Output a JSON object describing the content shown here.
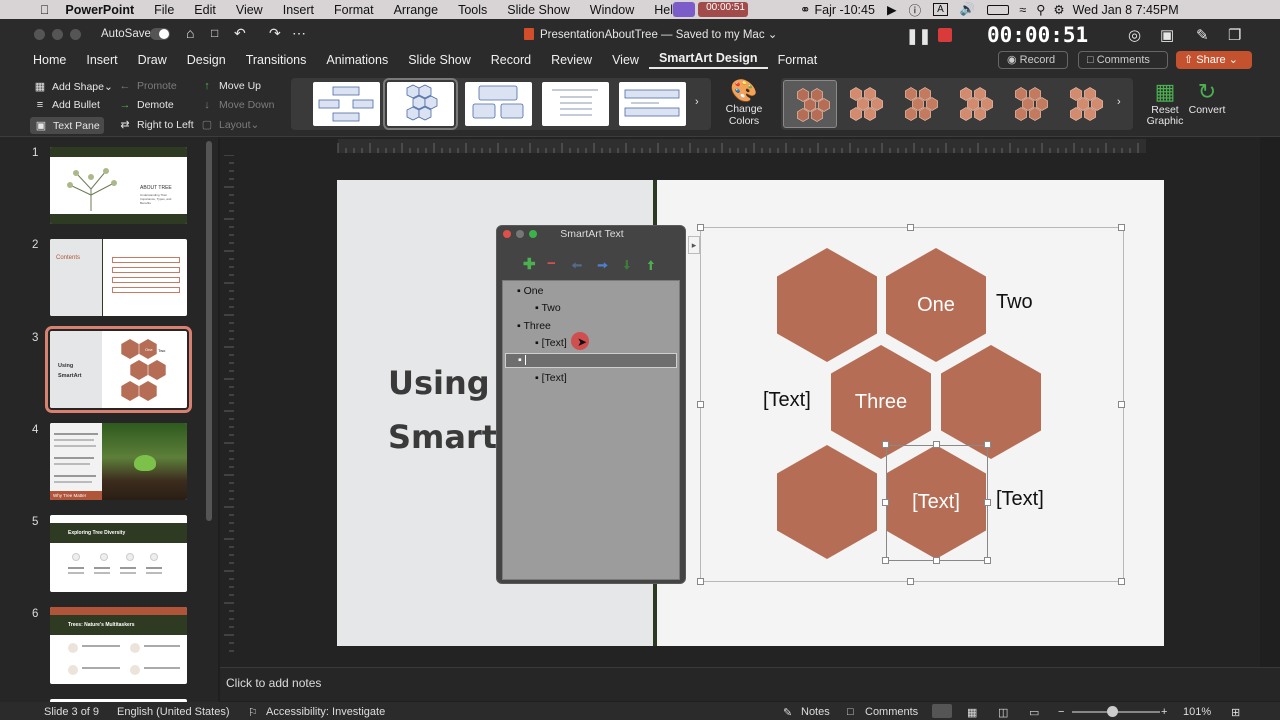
{
  "menubar": {
    "app": "PowerPoint",
    "items": [
      "File",
      "Edit",
      "View",
      "Insert",
      "Format",
      "Arrange",
      "Tools",
      "Slide Show",
      "Window",
      "Help"
    ],
    "rec_time": "00:00:51",
    "prayer": "Fajr -10:45",
    "clock": "Wed Jan 8  7:45PM"
  },
  "titlebar": {
    "autosave": "AutoSave",
    "doc_title": "PresentationAboutTree",
    "saved": "— Saved to my Mac",
    "timer": "00:00:51"
  },
  "tabs": [
    "Home",
    "Insert",
    "Draw",
    "Design",
    "Transitions",
    "Animations",
    "Slide Show",
    "Record",
    "Review",
    "View",
    "SmartArt Design",
    "Format"
  ],
  "tab_buttons": {
    "record": "Record",
    "comments": "Comments",
    "share": "Share"
  },
  "ribbon": {
    "add_shape": "Add Shape",
    "add_bullet": "Add Bullet",
    "text_pane": "Text Pane",
    "promote": "Promote",
    "demote": "Demote",
    "right_to_left": "Right to Left",
    "move_up": "Move Up",
    "move_down": "Move Down",
    "layout": "Layout",
    "change_colors_1": "Change",
    "change_colors_2": "Colors",
    "reset_graphic_1": "Reset",
    "reset_graphic_2": "Graphic",
    "convert": "Convert"
  },
  "slides": [
    {
      "num": "1",
      "title": "ABOUT TREE",
      "sub": "Understanding Their Importance, Types, and Benefits"
    },
    {
      "num": "2",
      "title": "Contents"
    },
    {
      "num": "3",
      "title1": "Using",
      "title2": "SmartArt",
      "hex_one": "One",
      "hex_two": "Two"
    },
    {
      "num": "4",
      "caption": "Why Tree Matter"
    },
    {
      "num": "5",
      "title": "Exploring Tree Diversity"
    },
    {
      "num": "6",
      "title": "Trees: Nature's Multitaskers"
    }
  ],
  "slide": {
    "title_line1": "Using",
    "title_line2": "SmartA"
  },
  "smartart": {
    "one": "One",
    "two": "Two",
    "three": "Three",
    "text1": "[Text]",
    "text2": "[Text]",
    "text3": "[Text]"
  },
  "textpane": {
    "title": "SmartArt Text",
    "items": [
      "One",
      "Two",
      "Three",
      "[Text]",
      "",
      "[Text]"
    ]
  },
  "notes": {
    "placeholder": "Click to add notes"
  },
  "status": {
    "slide": "Slide 3 of 9",
    "language": "English (United States)",
    "accessibility": "Accessibility: Investigate",
    "notes": "Notes",
    "comments": "Comments",
    "zoom": "101%"
  },
  "colors": {
    "hex": "#b56d55",
    "accent": "#d24d2a",
    "selection": "#d98070"
  }
}
